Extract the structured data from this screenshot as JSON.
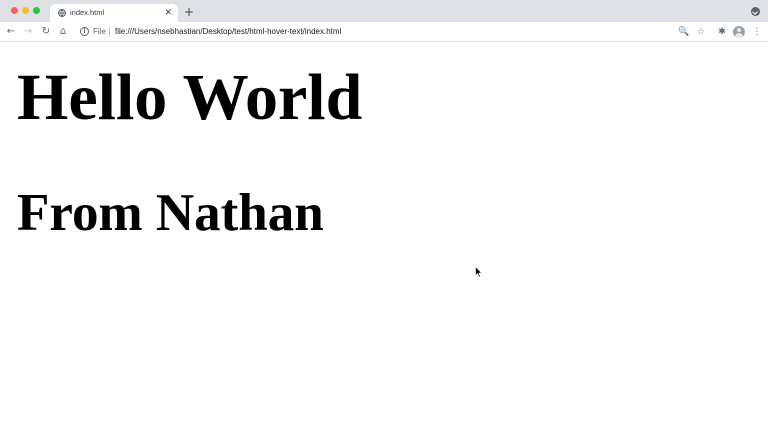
{
  "browser": {
    "tab": {
      "title": "index.html",
      "favicon": "globe-icon",
      "close_glyph": "✕"
    },
    "new_tab_glyph": "+",
    "toolbar": {
      "back_glyph": "←",
      "forward_glyph": "→",
      "reload_glyph": "↻",
      "home_glyph": "⌂",
      "info_glyph": "i",
      "site_chip": "File",
      "url": "file:///Users/nsebhastian/Desktop/test/html-hover-text/index.html",
      "zoom_glyph": "🔍",
      "bookmark_glyph": "☆",
      "extensions_glyph": "✱",
      "menu_glyph": "⋮"
    }
  },
  "page": {
    "heading": "Hello World",
    "subheading": "From Nathan"
  },
  "colors": {
    "tabstrip": "#dee1e6",
    "close": "#fe5f57",
    "minimize": "#febc2e",
    "maximize": "#28c840"
  }
}
